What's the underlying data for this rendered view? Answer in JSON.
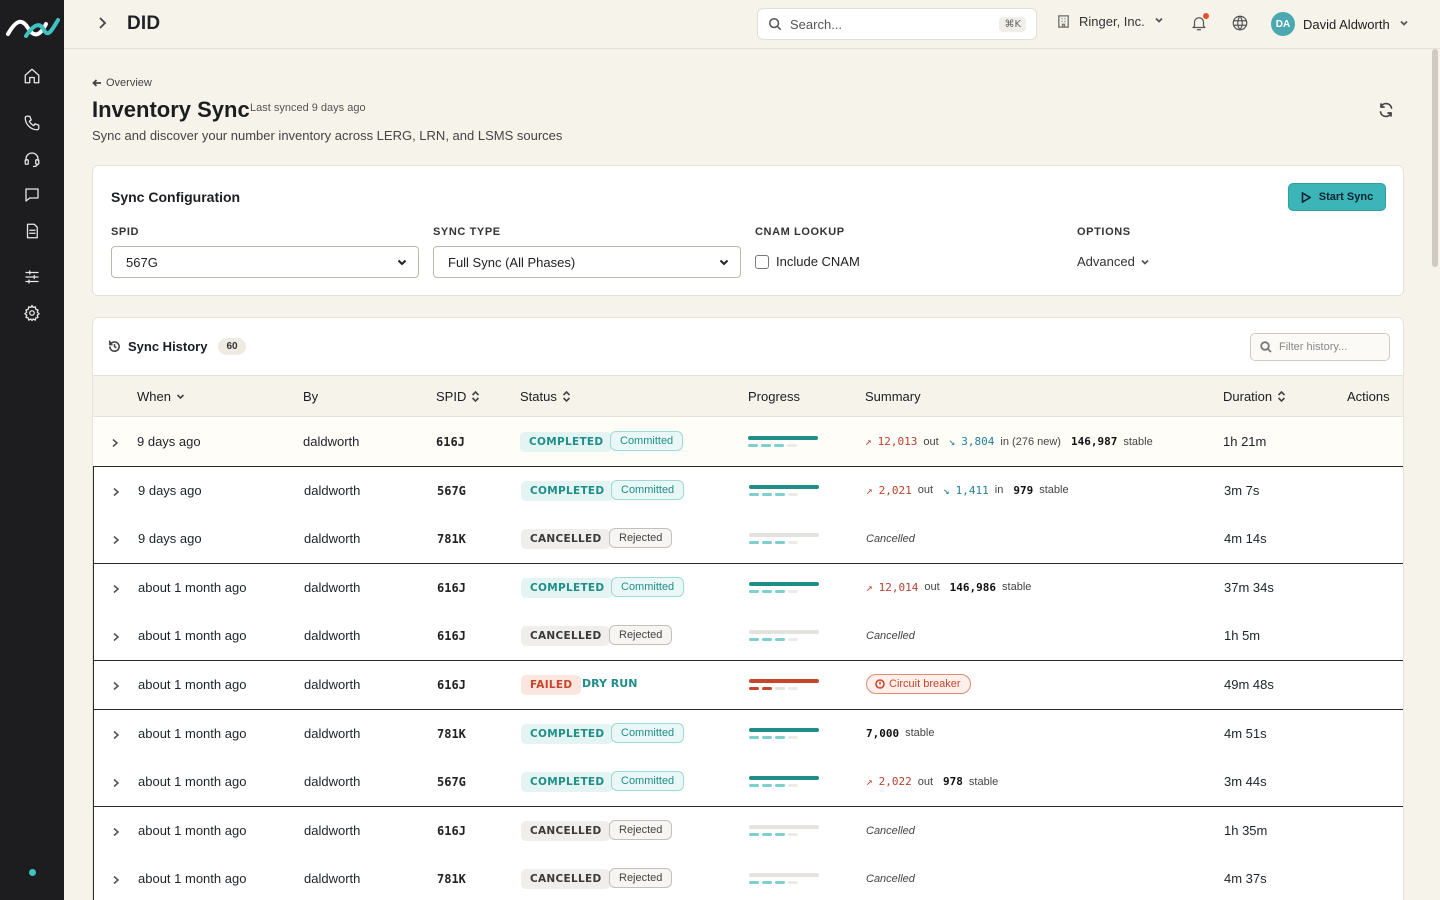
{
  "topbar": {
    "title": "DID",
    "search_placeholder": "Search...",
    "search_shortcut": "⌘K",
    "org_name": "Ringer, Inc.",
    "user_initials": "DA",
    "user_name": "David Aldworth"
  },
  "sidebar": {
    "items": [
      "home-icon",
      "phone-icon",
      "headset-icon",
      "message-icon",
      "document-icon",
      "sliders-icon",
      "gear-icon"
    ]
  },
  "header": {
    "back_label": "Overview",
    "title": "Inventory Sync",
    "last_synced": "Last synced 9 days ago",
    "subtitle": "Sync and discover your number inventory across LERG, LRN, and LSMS sources"
  },
  "config": {
    "title": "Sync Configuration",
    "start_button": "Start Sync",
    "spid_label": "SPID",
    "spid_value": "567G",
    "sync_type_label": "SYNC TYPE",
    "sync_type_value": "Full Sync (All Phases)",
    "cnam_label": "CNAM LOOKUP",
    "cnam_checkbox": "Include CNAM",
    "options_label": "OPTIONS",
    "options_value": "Advanced"
  },
  "history": {
    "title": "Sync History",
    "count": "60",
    "filter_placeholder": "Filter history...",
    "columns": {
      "when": "When",
      "by": "By",
      "spid": "SPID",
      "status": "Status",
      "progress": "Progress",
      "summary": "Summary",
      "duration": "Duration",
      "actions": "Actions"
    },
    "rows": [
      {
        "when": "9 days ago",
        "by": "daldworth",
        "spid": "616J",
        "status": "COMPLETED",
        "result": "Committed",
        "progress": 1.0,
        "out": "12,013",
        "out_label": "out",
        "in": "3,804",
        "in_label": "in (276 new)",
        "stable": "146,987",
        "stable_label": "stable",
        "duration": "1h 21m"
      },
      {
        "when": "9 days ago",
        "by": "daldworth",
        "spid": "567G",
        "status": "COMPLETED",
        "result": "Committed",
        "progress": 1.0,
        "out": "2,021",
        "out_label": "out",
        "in": "1,411",
        "in_label": "in",
        "stable": "979",
        "stable_label": "stable",
        "duration": "3m 7s"
      },
      {
        "when": "9 days ago",
        "by": "daldworth",
        "spid": "781K",
        "status": "CANCELLED",
        "result": "Rejected",
        "progress": 0,
        "note": "Cancelled",
        "duration": "4m 14s"
      },
      {
        "when": "about 1 month ago",
        "by": "daldworth",
        "spid": "616J",
        "status": "COMPLETED",
        "result": "Committed",
        "progress": 1.0,
        "out": "12,014",
        "out_label": "out",
        "stable": "146,986",
        "stable_label": "stable",
        "duration": "37m 34s"
      },
      {
        "when": "about 1 month ago",
        "by": "daldworth",
        "spid": "616J",
        "status": "CANCELLED",
        "result": "Rejected",
        "progress": 0,
        "note": "Cancelled",
        "duration": "1h 5m"
      },
      {
        "when": "about 1 month ago",
        "by": "daldworth",
        "spid": "616J",
        "status": "FAILED",
        "result": "DRY RUN",
        "progress": 1.0,
        "error": "Circuit breaker",
        "duration": "49m 48s"
      },
      {
        "when": "about 1 month ago",
        "by": "daldworth",
        "spid": "781K",
        "status": "COMPLETED",
        "result": "Committed",
        "progress": 1.0,
        "stable": "7,000",
        "stable_label": "stable",
        "duration": "4m 51s"
      },
      {
        "when": "about 1 month ago",
        "by": "daldworth",
        "spid": "567G",
        "status": "COMPLETED",
        "result": "Committed",
        "progress": 1.0,
        "out": "2,022",
        "out_label": "out",
        "stable": "978",
        "stable_label": "stable",
        "duration": "3m 44s"
      },
      {
        "when": "about 1 month ago",
        "by": "daldworth",
        "spid": "616J",
        "status": "CANCELLED",
        "result": "Rejected",
        "progress": 0,
        "note": "Cancelled",
        "duration": "1h 35m"
      },
      {
        "when": "about 1 month ago",
        "by": "daldworth",
        "spid": "781K",
        "status": "CANCELLED",
        "result": "Rejected",
        "progress": 0,
        "note": "Cancelled",
        "duration": "4m 37s"
      }
    ]
  },
  "colors": {
    "accent": "#3bb5b8",
    "completed": "#1f8e88",
    "failed": "#c8452c",
    "sidebar": "#1d1d1f",
    "background": "#f6f3ea"
  }
}
